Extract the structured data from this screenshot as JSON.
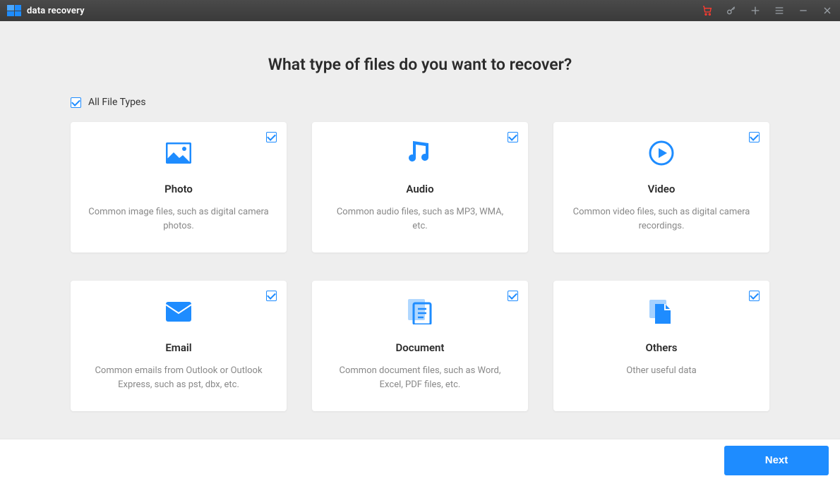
{
  "app_name": "data recovery",
  "heading": "What type of files do you want to recover?",
  "all_files": {
    "label": "All File Types",
    "checked": true
  },
  "cards": [
    {
      "title": "Photo",
      "desc": "Common image files, such as digital camera photos.",
      "checked": true
    },
    {
      "title": "Audio",
      "desc": "Common audio files, such as MP3, WMA, etc.",
      "checked": true
    },
    {
      "title": "Video",
      "desc": "Common video files, such as digital camera recordings.",
      "checked": true
    },
    {
      "title": "Email",
      "desc": "Common emails from Outlook or Outlook Express, such as pst, dbx, etc.",
      "checked": true
    },
    {
      "title": "Document",
      "desc": "Common document files, such as Word, Excel, PDF files, etc.",
      "checked": true
    },
    {
      "title": "Others",
      "desc": "Other useful data",
      "checked": true
    }
  ],
  "next_label": "Next",
  "colors": {
    "accent": "#1e8cff",
    "cart": "#ff3b30"
  }
}
